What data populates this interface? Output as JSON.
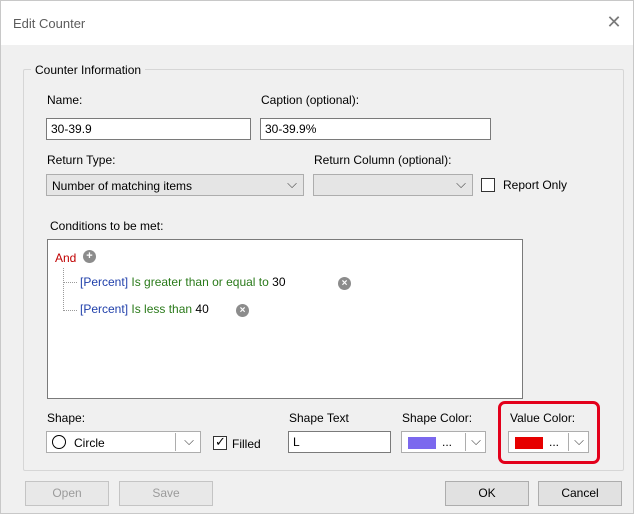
{
  "window": {
    "title": "Edit Counter",
    "close_glyph": "✕"
  },
  "group": {
    "legend": "Counter Information"
  },
  "name": {
    "label": "Name:",
    "value": "30-39.9"
  },
  "caption": {
    "label": "Caption (optional):",
    "value": "30-39.9%"
  },
  "return_type": {
    "label": "Return Type:",
    "value": "Number of matching items"
  },
  "return_column": {
    "label": "Return Column (optional):",
    "value": ""
  },
  "report_only": {
    "label": "Report Only",
    "checked": false
  },
  "conditions": {
    "label": "Conditions to be met:",
    "root": "And",
    "items": [
      {
        "field": "[Percent]",
        "operator": "Is greater than or equal to",
        "value": "30"
      },
      {
        "field": "[Percent]",
        "operator": "Is less than",
        "value": "40"
      }
    ]
  },
  "shape": {
    "label": "Shape:",
    "value": "Circle",
    "filled_label": "Filled",
    "filled_checked": true
  },
  "shape_text": {
    "label": "Shape Text",
    "value": "L"
  },
  "shape_color": {
    "label": "Shape Color:",
    "color": "#7b68ee",
    "more": "..."
  },
  "value_color": {
    "label": "Value Color:",
    "color": "#e60000",
    "more": "..."
  },
  "buttons": {
    "open": "Open",
    "save": "Save",
    "ok": "OK",
    "cancel": "Cancel"
  },
  "glyphs": {
    "chevron": "⌵",
    "check": "✓",
    "plus": "+",
    "remove": "×"
  }
}
